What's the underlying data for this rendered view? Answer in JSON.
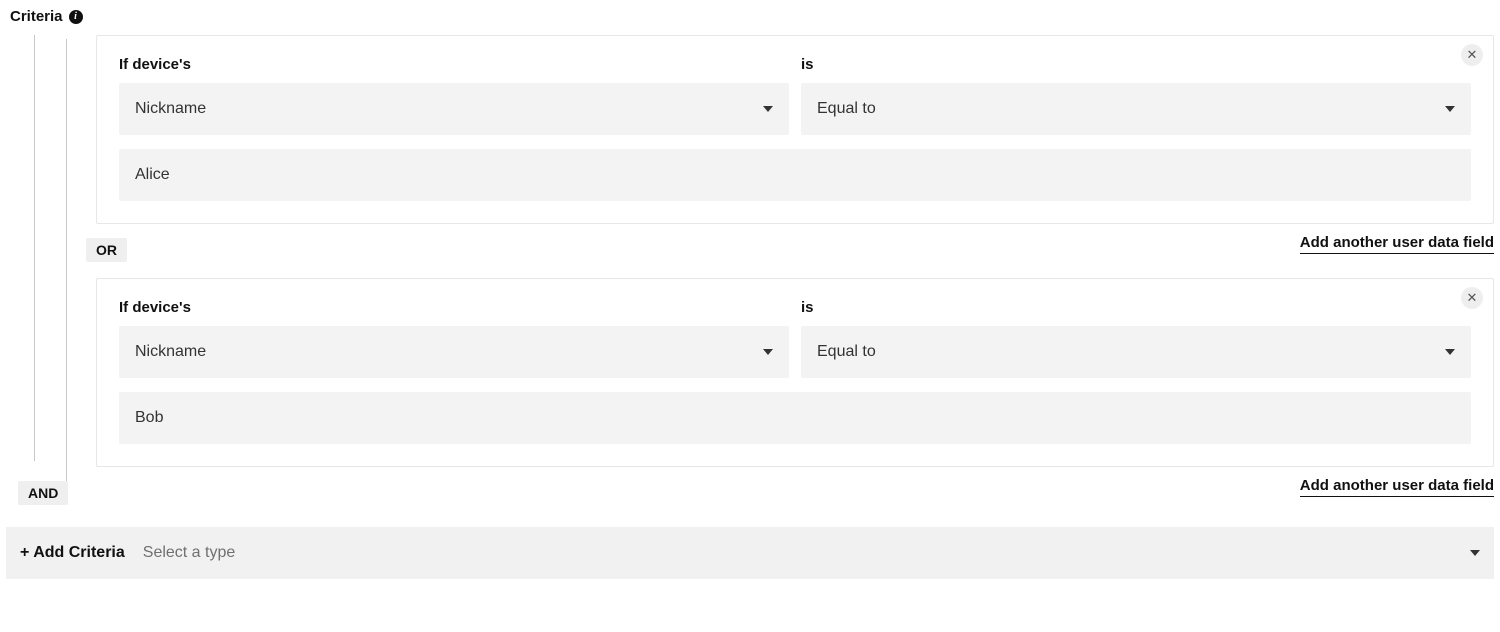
{
  "header": {
    "title": "Criteria"
  },
  "connectors": {
    "or": "OR",
    "and": "AND"
  },
  "labels": {
    "if_device": "If device's",
    "is": "is"
  },
  "links": {
    "add_field": "Add another user data field"
  },
  "rules": [
    {
      "field": "Nickname",
      "operator": "Equal to",
      "value": "Alice"
    },
    {
      "field": "Nickname",
      "operator": "Equal to",
      "value": "Bob"
    }
  ],
  "footer": {
    "add_criteria_label": "+ Add Criteria",
    "placeholder": "Select a type"
  }
}
